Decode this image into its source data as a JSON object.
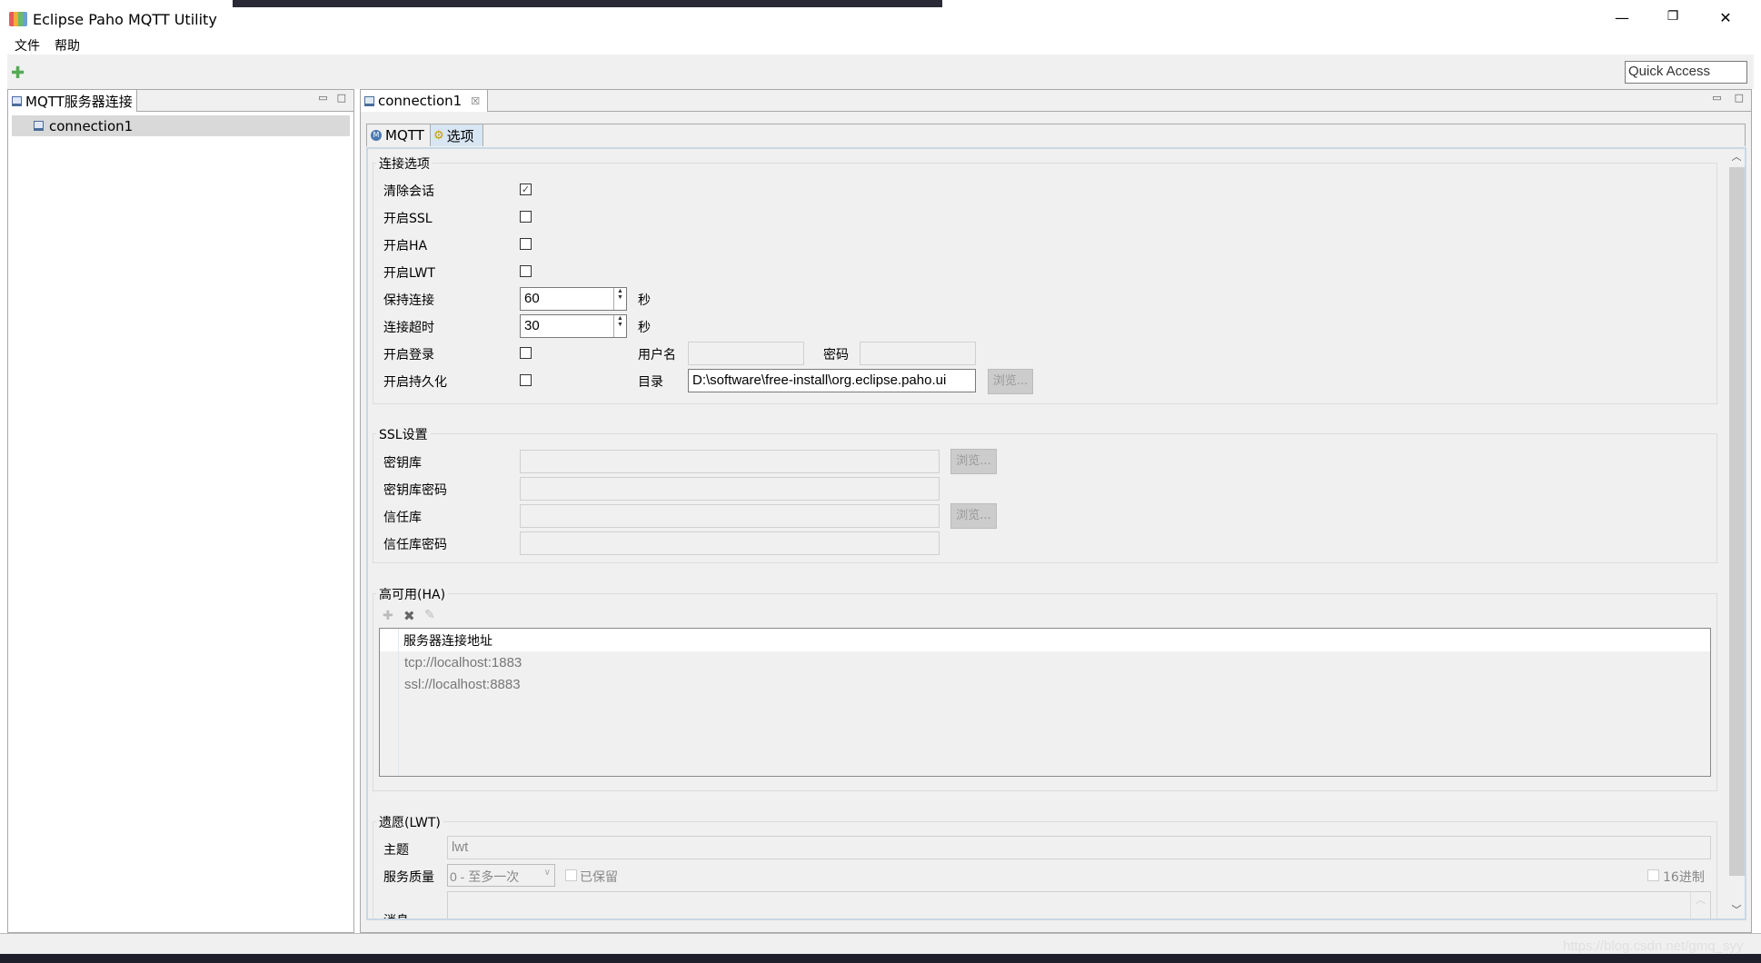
{
  "window": {
    "title": "Eclipse Paho MQTT Utility",
    "minimize": "—",
    "restore": "❐",
    "close": "✕"
  },
  "menu": [
    {
      "label": "文件"
    },
    {
      "label": "帮助"
    }
  ],
  "toolbar": {
    "add_icon": "plus-icon",
    "quick_access": "Quick Access"
  },
  "left_panel": {
    "tab": "MQTT服务器连接",
    "items": [
      {
        "label": "connection1"
      }
    ]
  },
  "editor": {
    "tab": "connection1",
    "close": "☒",
    "subtabs": [
      {
        "label": "MQTT"
      },
      {
        "label": "选项",
        "selected": true
      }
    ]
  },
  "connection_options": {
    "title": "连接选项",
    "clean_session": {
      "label": "清除会话",
      "checked": true
    },
    "ssl": {
      "label": "开启SSL",
      "checked": false
    },
    "ha": {
      "label": "开启HA",
      "checked": false
    },
    "lwt": {
      "label": "开启LWT",
      "checked": false
    },
    "keepalive": {
      "label": "保持连接",
      "value": "60",
      "unit": "秒"
    },
    "timeout": {
      "label": "连接超时",
      "value": "30",
      "unit": "秒"
    },
    "login": {
      "label": "开启登录",
      "checked": false,
      "username_label": "用户名",
      "username": "",
      "password_label": "密码",
      "password": ""
    },
    "persistence": {
      "label": "开启持久化",
      "checked": false,
      "dir_label": "目录",
      "dir": "D:\\software\\free-install\\org.eclipse.paho.ui",
      "browse": "浏览..."
    }
  },
  "ssl_settings": {
    "title": "SSL设置",
    "keystore": "密钥库",
    "keystore_password": "密钥库密码",
    "truststore": "信任库",
    "truststore_password": "信任库密码",
    "browse": "浏览..."
  },
  "ha": {
    "title": "高可用(HA)",
    "column": "服务器连接地址",
    "rows": [
      "tcp://localhost:1883",
      "ssl://localhost:8883"
    ]
  },
  "lwt": {
    "title": "遗愿(LWT)",
    "topic_label": "主题",
    "topic": "lwt",
    "qos_label": "服务质量",
    "qos": "0 - 至多一次",
    "retained": "已保留",
    "hex": "16进制",
    "message_label": "消息"
  },
  "watermark": "https://blog.csdn.net/gmq_syy"
}
